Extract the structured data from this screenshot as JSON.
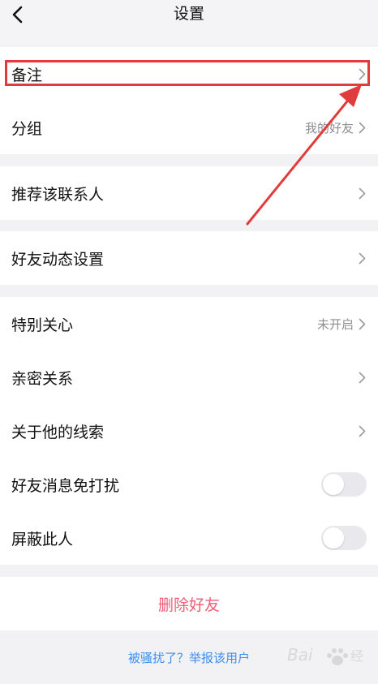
{
  "header": {
    "title": "设置",
    "back_icon": "chevron-left-icon"
  },
  "groups": [
    {
      "rows": [
        {
          "label": "备注",
          "value": "",
          "type": "chevron"
        },
        {
          "label": "分组",
          "value": "我的好友",
          "type": "chevron"
        }
      ]
    },
    {
      "rows": [
        {
          "label": "推荐该联系人",
          "value": "",
          "type": "chevron"
        }
      ]
    },
    {
      "rows": [
        {
          "label": "好友动态设置",
          "value": "",
          "type": "chevron"
        }
      ]
    },
    {
      "rows": [
        {
          "label": "特别关心",
          "value": "未开启",
          "type": "chevron"
        },
        {
          "label": "亲密关系",
          "value": "",
          "type": "chevron"
        },
        {
          "label": "关于他的线索",
          "value": "",
          "type": "chevron"
        },
        {
          "label": "好友消息免打扰",
          "value": "",
          "type": "toggle",
          "on": false
        },
        {
          "label": "屏蔽此人",
          "value": "",
          "type": "toggle",
          "on": false
        }
      ]
    }
  ],
  "delete_button": {
    "label": "删除好友",
    "color": "#ef5d77"
  },
  "report_link": {
    "label": "被骚扰了？举报该用户",
    "color": "#3b8ff0"
  },
  "annotation": {
    "color": "#e23b3b"
  }
}
